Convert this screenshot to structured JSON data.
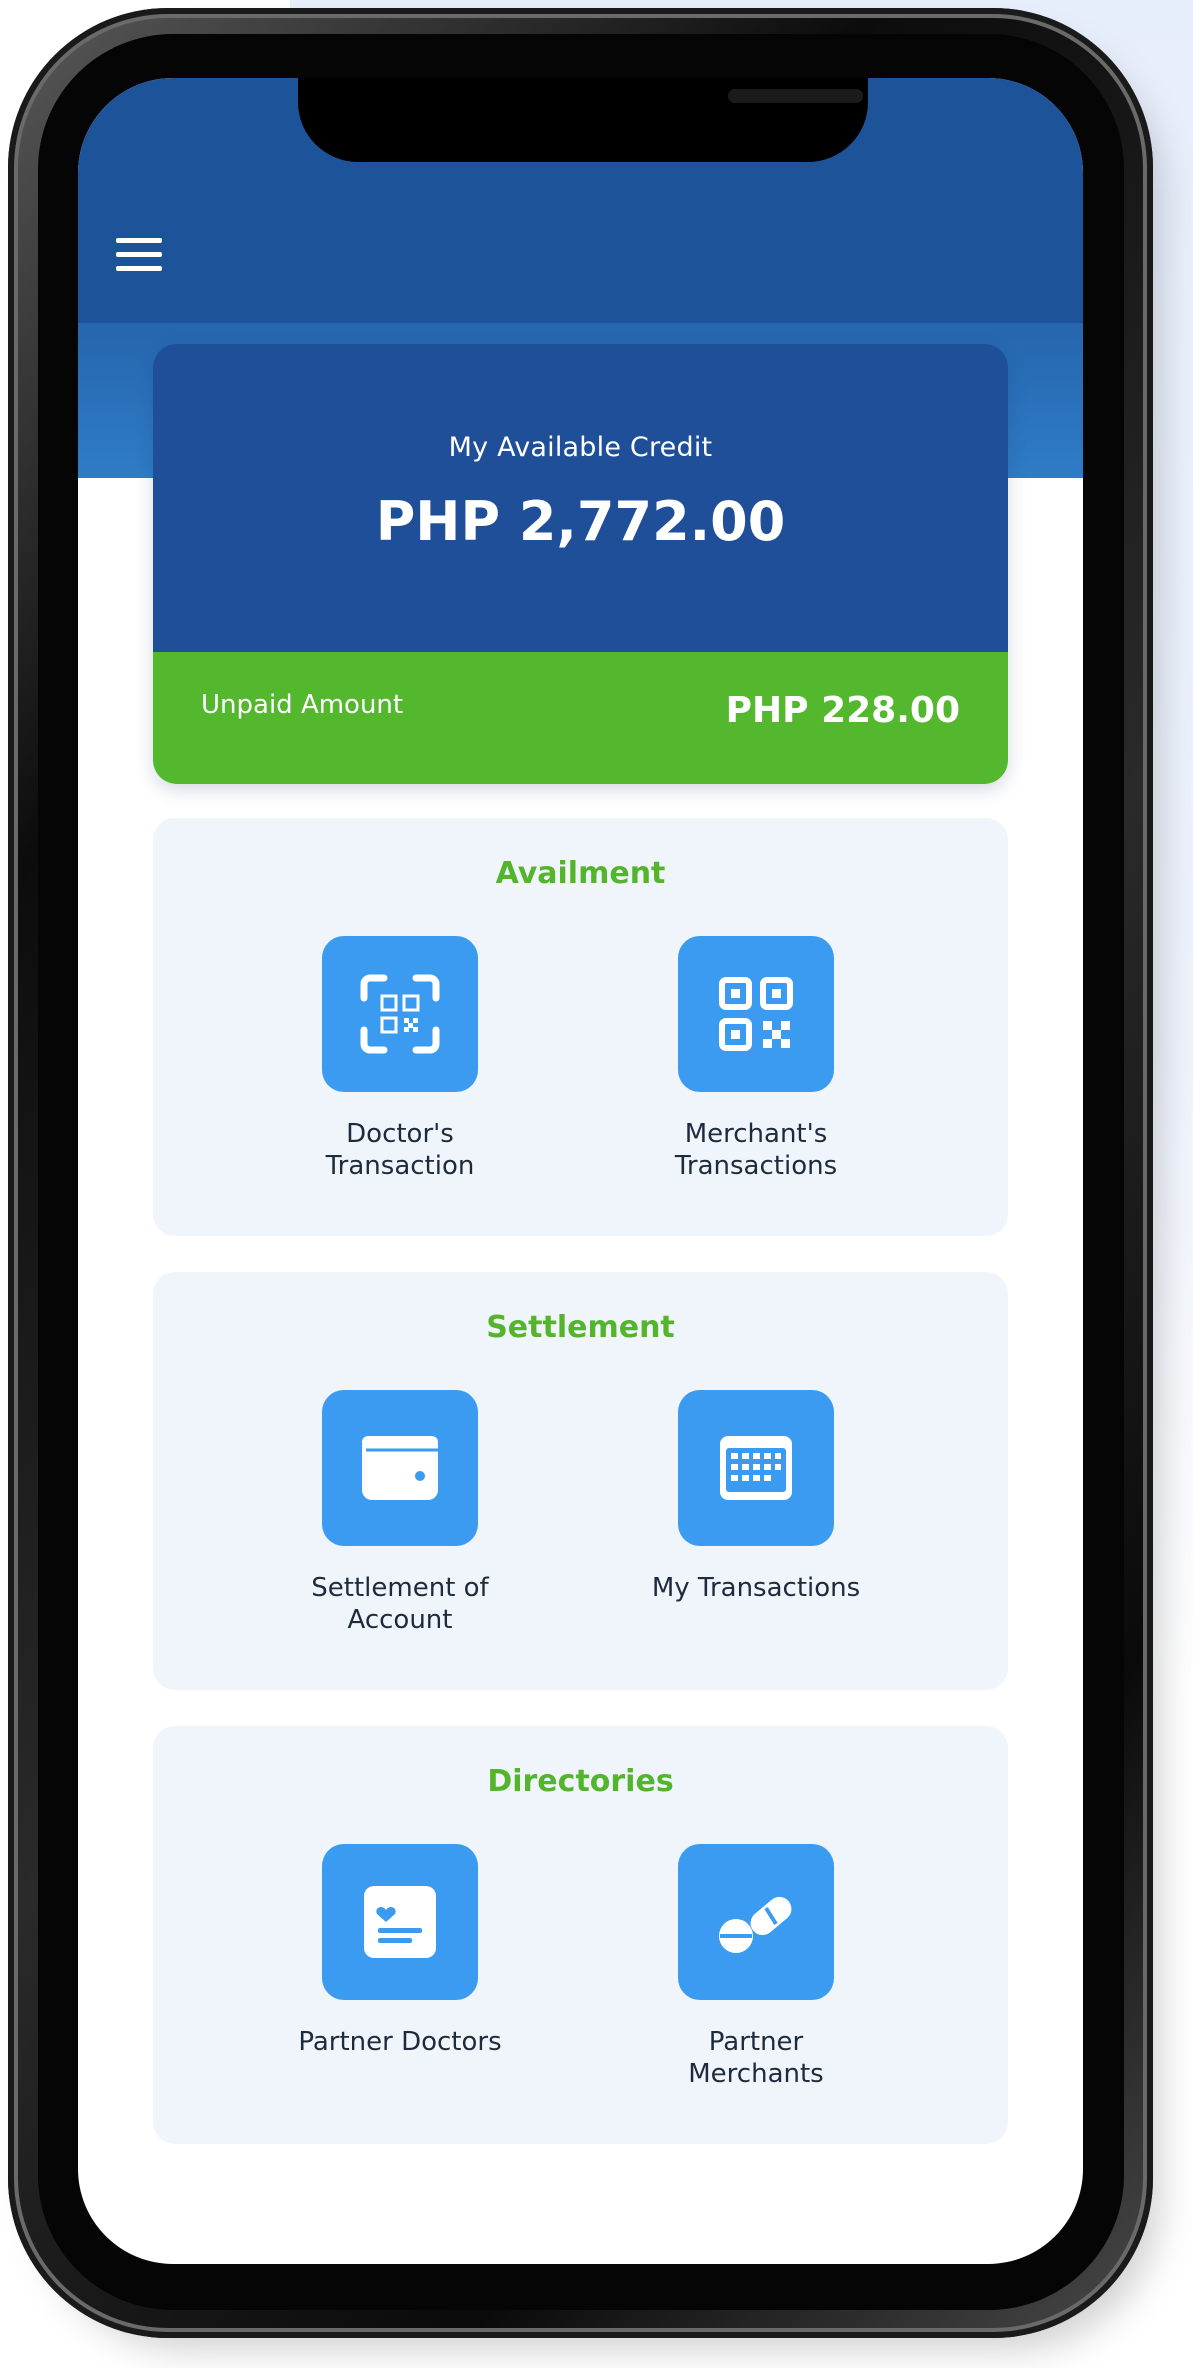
{
  "credit": {
    "label": "My Available Credit",
    "amount": "PHP 2,772.00",
    "unpaid_label": "Unpaid Amount",
    "unpaid_amount": "PHP 228.00"
  },
  "sections": [
    {
      "title": "Availment",
      "items": [
        {
          "label_line1": "Doctor's",
          "label_line2": "Transaction",
          "icon": "qr-scan-icon"
        },
        {
          "label_line1": "Merchant's",
          "label_line2": "Transactions",
          "icon": "qr-code-icon"
        }
      ]
    },
    {
      "title": "Settlement",
      "items": [
        {
          "label_line1": "Settlement of",
          "label_line2": "Account",
          "icon": "wallet-icon"
        },
        {
          "label_line1": "My Transactions",
          "label_line2": "",
          "icon": "calendar-icon"
        }
      ]
    },
    {
      "title": "Directories",
      "items": [
        {
          "label_line1": "Partner Doctors",
          "label_line2": "",
          "icon": "medical-id-icon"
        },
        {
          "label_line1": "Partner",
          "label_line2": "Merchants",
          "icon": "pills-icon"
        }
      ]
    }
  ],
  "colors": {
    "header_blue": "#1d5399",
    "card_blue": "#1e4f98",
    "unpaid_green": "#53b82e",
    "section_title_green": "#54b52d",
    "tile_blue": "#3a9bf0",
    "section_bg": "#f0f4fb"
  },
  "icons": [
    "menu-icon",
    "qr-scan-icon",
    "qr-code-icon",
    "wallet-icon",
    "calendar-icon",
    "medical-id-icon",
    "pills-icon"
  ]
}
